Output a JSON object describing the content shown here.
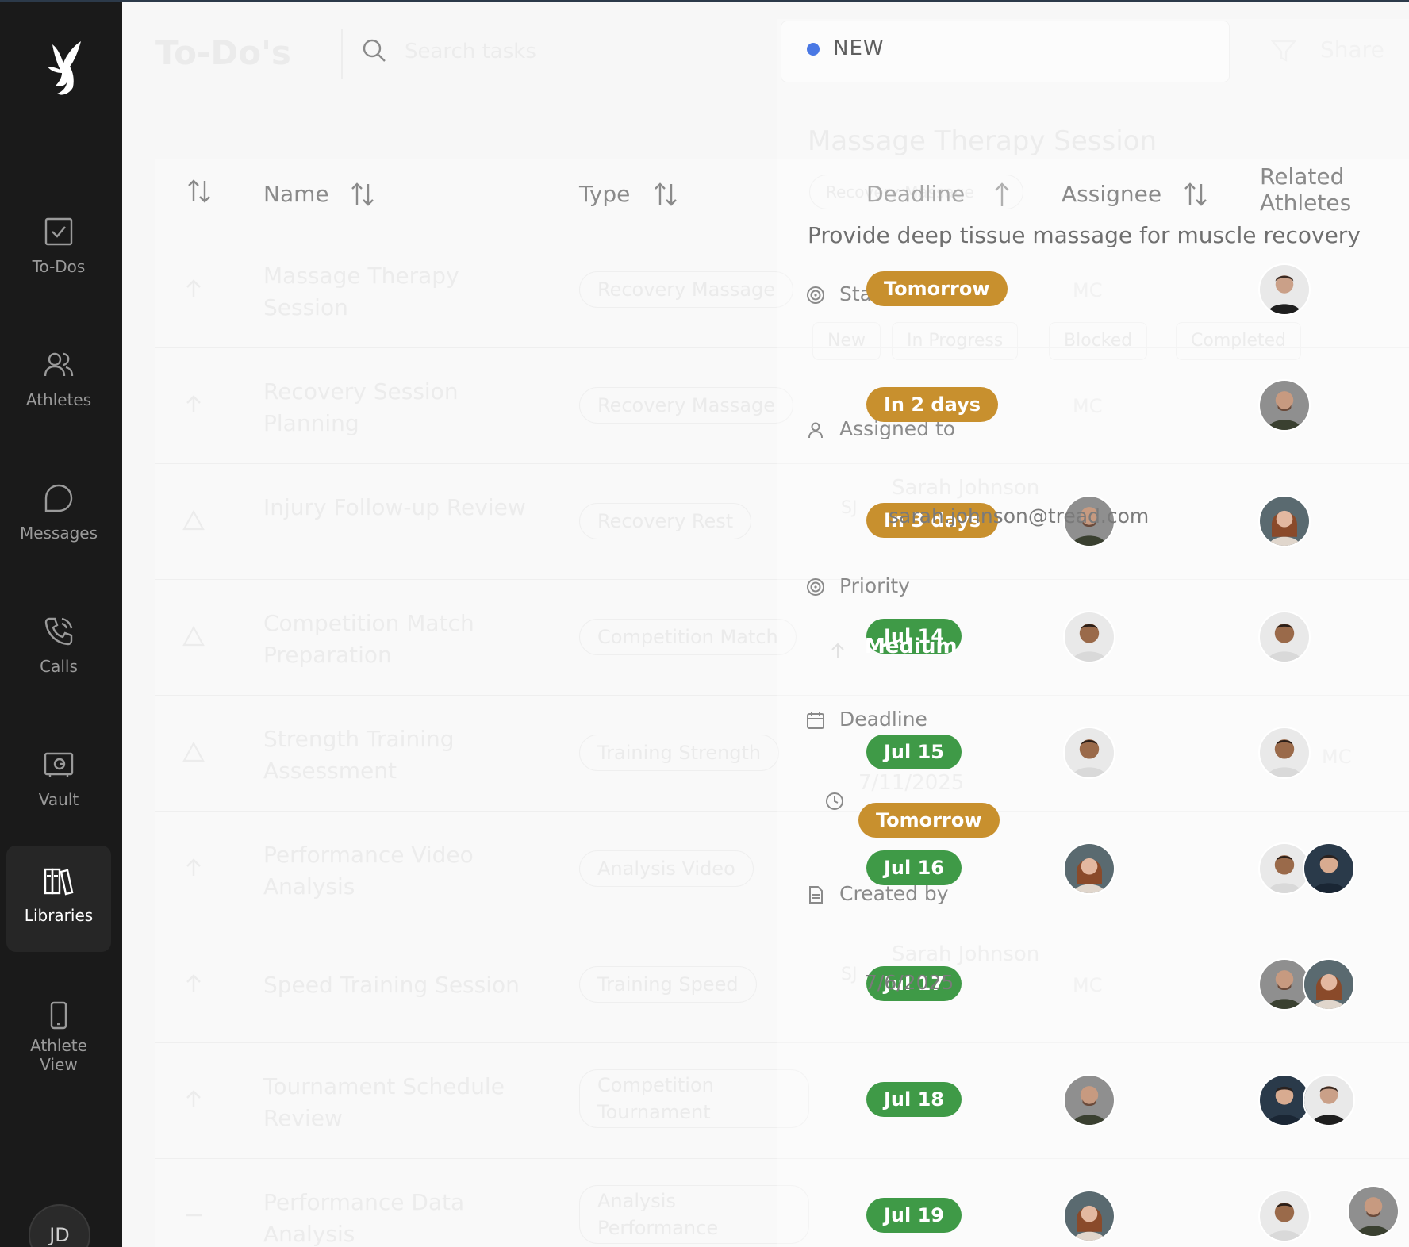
{
  "app": {
    "logo": "brand-logo",
    "user_initials": "JD"
  },
  "nav": [
    {
      "label": "To-Dos",
      "icon": "checkbox-icon"
    },
    {
      "label": "Athletes",
      "icon": "users-icon"
    },
    {
      "label": "Messages",
      "icon": "chat-bubble-icon"
    },
    {
      "label": "Calls",
      "icon": "phone-icon"
    },
    {
      "label": "Vault",
      "icon": "vault-icon"
    },
    {
      "label": "Libraries",
      "icon": "books-icon",
      "active": true
    },
    {
      "label": "Athlete",
      "label2": "View",
      "icon": "mobile-icon"
    }
  ],
  "header": {
    "title": "To-Do's",
    "search_placeholder": "Search tasks",
    "share_label": "Share"
  },
  "table": {
    "columns": {
      "name": "Name",
      "type": "Type",
      "deadline": "Deadline",
      "assignee": "Assignee",
      "related1": "Related",
      "related2": "Athletes"
    },
    "rows": [
      {
        "name": "Massage Therapy Session",
        "type": "Recovery Massage",
        "deadline": "Tomorrow",
        "deadline_style": "amber",
        "assignee_initials": "MC"
      },
      {
        "name": "Recovery Session Planning",
        "type": "Recovery Massage",
        "deadline": "In 2 days",
        "deadline_style": "amber",
        "assignee_initials": "MC"
      },
      {
        "name": "Injury Follow-up Review",
        "type": "Recovery Rest",
        "deadline": "In 3 days",
        "deadline_style": "amber"
      },
      {
        "name": "Competition Match Preparation",
        "type": "Competition Match",
        "deadline": "Jul 14",
        "deadline_style": "green"
      },
      {
        "name": "Strength Training Assessment",
        "type": "Training Strength",
        "deadline": "Jul 15",
        "deadline_style": "green",
        "related_initials": "MC"
      },
      {
        "name": "Performance Video Analysis",
        "type": "Analysis Video",
        "deadline": "Jul 16",
        "deadline_style": "green"
      },
      {
        "name": "Speed Training Session",
        "type": "Training Speed",
        "deadline": "Jul 17",
        "deadline_style": "green",
        "assignee_initials": "MC"
      },
      {
        "name": "Tournament Schedule Review",
        "type": "Competition Tournament",
        "deadline": "Jul 18",
        "deadline_style": "green"
      },
      {
        "name": "Performance Data Analysis",
        "type": "Analysis Performance",
        "deadline": "Jul 19",
        "deadline_style": "green"
      }
    ]
  },
  "detail": {
    "status": "NEW",
    "title": "Massage Therapy Session",
    "tag": "Recovery Massage",
    "description": "Provide deep tissue massage for muscle recovery",
    "status_label": "Status",
    "status_options": [
      "New",
      "In Progress",
      "Blocked",
      "Completed"
    ],
    "assigned_label": "Assigned to",
    "assignee_name": "Sarah Johnson",
    "assignee_email": "sarah.johnson@tread.com",
    "assignee_initials": "SJ",
    "priority_label": "Priority",
    "priority_value": "Medium",
    "deadline_label": "Deadline",
    "deadline_date": "7/11/2025",
    "deadline_relative": "Tomorrow",
    "created_label": "Created by",
    "creator_name": "Sarah Johnson",
    "creator_initials": "SJ",
    "created_date": "7/6/2025"
  },
  "colors": {
    "sidebar": "#1a1a1a",
    "amber": "#c8902e",
    "green": "#3f9a47",
    "status_dot": "#4a78e4"
  }
}
